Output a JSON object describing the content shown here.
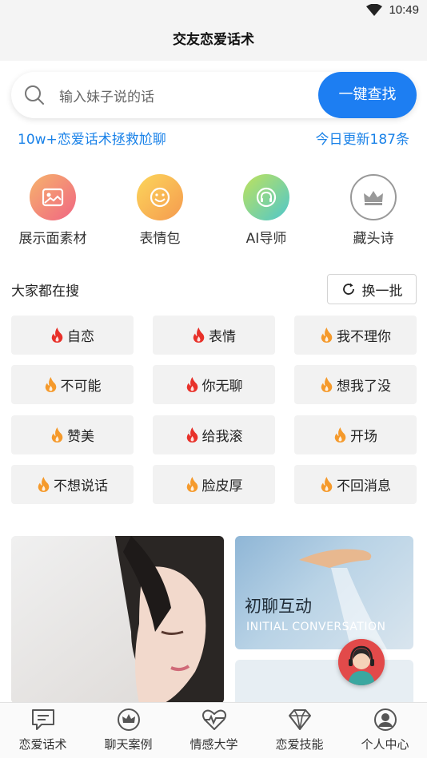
{
  "status_bar": {
    "time": "10:49",
    "wifi_icon": "wifi-icon"
  },
  "header": {
    "title": "交友恋爱话术"
  },
  "search": {
    "placeholder": "输入妹子说的话",
    "button_label": "一键查找",
    "icon": "search-icon"
  },
  "promo": {
    "left_text": "10w+恋爱话术拯救尬聊",
    "right_text": "今日更新187条"
  },
  "features": [
    {
      "label": "展示面素材",
      "icon": "image-icon",
      "color_from": "#f4a06a",
      "color_to": "#f06b84"
    },
    {
      "label": "表情包",
      "icon": "smiley-icon",
      "color_from": "#fbd25a",
      "color_to": "#f59a4f"
    },
    {
      "label": "AI导师",
      "icon": "headset-icon",
      "color_from": "#b6df62",
      "color_to": "#55c9c7"
    },
    {
      "label": "藏头诗",
      "icon": "crown-icon",
      "color_from": "#ffffff",
      "color_to": "#ffffff"
    }
  ],
  "hot_search": {
    "title": "大家都在搜",
    "refresh_label": "换一批",
    "tags": [
      {
        "label": "自恋",
        "flame": "red"
      },
      {
        "label": "表情",
        "flame": "red"
      },
      {
        "label": "我不理你",
        "flame": "orange"
      },
      {
        "label": "不可能",
        "flame": "orange"
      },
      {
        "label": "你无聊",
        "flame": "red"
      },
      {
        "label": "想我了没",
        "flame": "orange"
      },
      {
        "label": "赞美",
        "flame": "orange"
      },
      {
        "label": "给我滚",
        "flame": "red"
      },
      {
        "label": "开场",
        "flame": "orange"
      },
      {
        "label": "不想说话",
        "flame": "orange"
      },
      {
        "label": "脸皮厚",
        "flame": "orange"
      },
      {
        "label": "不回消息",
        "flame": "orange"
      }
    ]
  },
  "cards": {
    "right_top": {
      "title": "初聊互动",
      "subtitle": "INITIAL CONVERSATION"
    }
  },
  "tabbar": [
    {
      "label": "恋爱话术",
      "icon": "chat-icon"
    },
    {
      "label": "聊天案例",
      "icon": "crown-icon"
    },
    {
      "label": "情感大学",
      "icon": "heartbeat-icon"
    },
    {
      "label": "恋爱技能",
      "icon": "diamond-icon"
    },
    {
      "label": "个人中心",
      "icon": "user-icon"
    }
  ],
  "colors": {
    "accent": "#1d7ef2",
    "promo": "#1a82e8",
    "flame_red": "#e8312a",
    "flame_orange": "#f59a2c"
  }
}
